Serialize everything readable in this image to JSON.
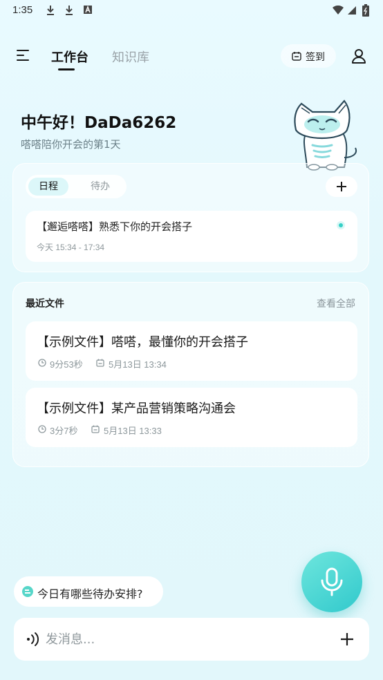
{
  "statusbar": {
    "time": "1:35"
  },
  "topbar": {
    "tabs": [
      {
        "label": "工作台",
        "active": true
      },
      {
        "label": "知识库",
        "active": false
      }
    ],
    "signin_label": "签到"
  },
  "greeting": {
    "title": "中午好！DaDa6262",
    "subtitle": "嗒嗒陪你开会的第1天"
  },
  "schedule": {
    "segments": [
      "日程",
      "待办"
    ],
    "events": [
      {
        "title": "【邂逅嗒嗒】熟悉下你的开会搭子",
        "time": "今天 15:34 - 17:34"
      }
    ]
  },
  "recent_files": {
    "heading": "最近文件",
    "view_all": "查看全部",
    "items": [
      {
        "title": "【示例文件】嗒嗒，最懂你的开会搭子",
        "duration": "9分53秒",
        "date": "5月13日 13:34"
      },
      {
        "title": "【示例文件】某产品营销策略沟通会",
        "duration": "3分7秒",
        "date": "5月13日 13:33"
      }
    ]
  },
  "suggestion": {
    "label": "今日有哪些待办安排?"
  },
  "input": {
    "placeholder": "发消息..."
  },
  "colors": {
    "accent": "#35d0c6",
    "mic_gradient_start": "#6ee6dd",
    "mic_gradient_end": "#31c9cc"
  },
  "icons": [
    "download-icon",
    "a-box-icon",
    "wifi-icon",
    "signal-icon",
    "battery-icon",
    "menu-icon",
    "calendar-icon",
    "user-icon",
    "plus-icon",
    "clock-icon",
    "mic-icon",
    "voice-icon",
    "chat-icon"
  ]
}
